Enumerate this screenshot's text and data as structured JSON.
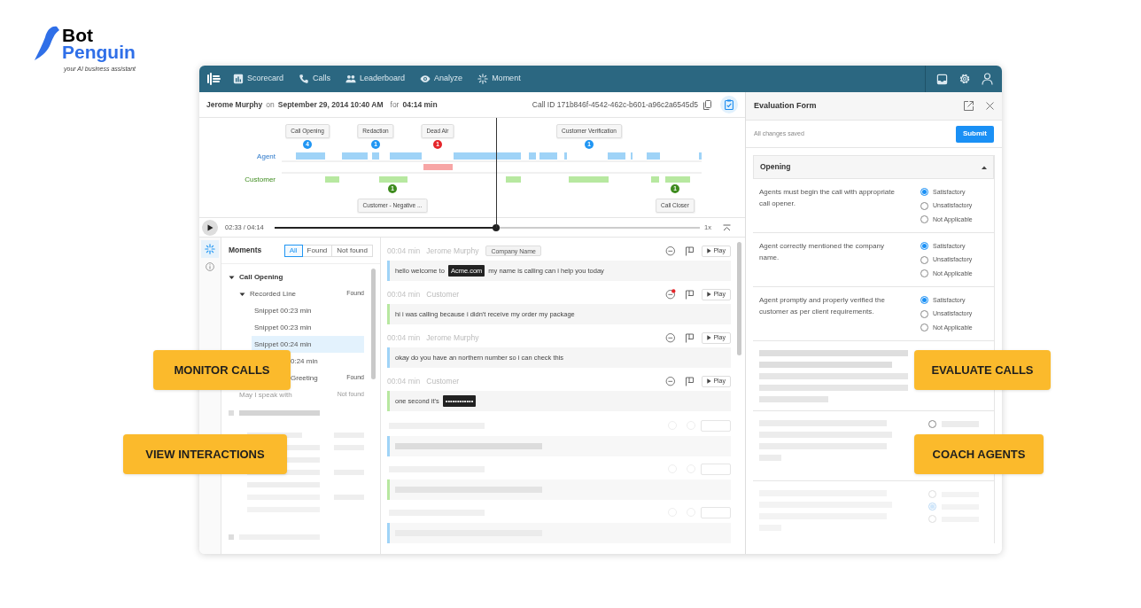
{
  "brand": {
    "name_top": "Bot",
    "name_bottom": "Penguin",
    "tagline": "your AI business assistant"
  },
  "nav": {
    "items": [
      {
        "label": "Scorecard"
      },
      {
        "label": "Calls"
      },
      {
        "label": "Leaderboard"
      },
      {
        "label": "Analyze"
      },
      {
        "label": "Moment"
      }
    ]
  },
  "call": {
    "agent": "Jerome Murphy",
    "on": "on",
    "date": "September 29, 2014 10:40 AM",
    "for": "for",
    "duration": "04:14 min",
    "call_id": "Call ID 171b846f-4542-462c-b601-a96c2a6545d5"
  },
  "timeline": {
    "agent_label": "Agent",
    "customer_label": "Customer",
    "markers": [
      {
        "label": "Call Opening",
        "count": "4",
        "color": "#2196f3",
        "kind": "top"
      },
      {
        "label": "Redaction",
        "count": "1",
        "color": "#2196f3",
        "kind": "top"
      },
      {
        "label": "Dead Air",
        "count": "1",
        "color": "#e5252a",
        "kind": "top"
      },
      {
        "label": "Customer Verification",
        "count": "1",
        "color": "#2196f3",
        "kind": "top"
      },
      {
        "label": "Customer - Negative ...",
        "count": "1",
        "color": "#3d8b1d",
        "kind": "bottom"
      },
      {
        "label": "Call Closer",
        "count": "1",
        "color": "#3d8b1d",
        "kind": "bottom"
      }
    ]
  },
  "player": {
    "time": "02:33 / 04:14",
    "level": 0.52,
    "speed": "1x"
  },
  "moments": {
    "title": "Moments",
    "filters": [
      {
        "label": "All",
        "selected": true
      },
      {
        "label": "Found",
        "selected": false
      },
      {
        "label": "Not found",
        "selected": false
      }
    ],
    "tree": [
      {
        "label": "Call Opening",
        "expanded": true,
        "children": [
          {
            "label": "Recorded Line",
            "status": "Found",
            "expanded": true,
            "disabled": false,
            "children": [
              {
                "label": "Snippet 00:23 min",
                "selected": false,
                "kind": "full"
              },
              {
                "label": "Snippet 00:23 min",
                "selected": false,
                "kind": "full"
              },
              {
                "label": "Snippet 00:24 min",
                "selected": true,
                "kind": "full"
              },
              {
                "label": "0:24 min",
                "selected": false,
                "kind": "clipped"
              }
            ]
          },
          {
            "label": "Greeting",
            "status": "Found",
            "disabled": false,
            "kind": "clipped"
          },
          {
            "label": "May I speak with",
            "status": "Not found",
            "disabled": true,
            "kind": "full"
          }
        ]
      }
    ]
  },
  "transcript": [
    {
      "time": "00:04 min",
      "speaker": "Jerome Murphy",
      "kind": "agent",
      "tag": "Company Name",
      "alert": false,
      "play": "Play",
      "parts": [
        {
          "text": "hello welcome to",
          "redacted": false
        },
        {
          "text": "Acme.com",
          "redacted": true
        },
        {
          "text": "my name is calling can i help you today",
          "redacted": false
        }
      ]
    },
    {
      "time": "00:04 min",
      "speaker": "Customer",
      "kind": "customer",
      "alert": true,
      "play": "Play",
      "parts": [
        {
          "text": "hi i was calling because i didn't receive my order my package",
          "redacted": false
        }
      ]
    },
    {
      "time": "00:04 min",
      "speaker": "Jerome Murphy",
      "kind": "agent",
      "alert": false,
      "play": "Play",
      "parts": [
        {
          "text": "okay do you have an northern number so i can check this",
          "redacted": false
        }
      ]
    },
    {
      "time": "00:04 min",
      "speaker": "Customer",
      "kind": "customer",
      "alert": false,
      "play": "Play",
      "parts": [
        {
          "text": "one second it's",
          "redacted": false
        },
        {
          "text": "••••••••••••",
          "redacted": true
        }
      ]
    }
  ],
  "evaluation": {
    "title": "Evaluation Form",
    "save_status": "All changes saved",
    "submit": "Submit",
    "section": {
      "title": "Opening",
      "expanded": true,
      "questions": [
        {
          "text": "Agents must begin the call with appropriate call opener.",
          "options": [
            {
              "label": "Satisfactory",
              "selected": true
            },
            {
              "label": "Unsatisfactory",
              "selected": false
            },
            {
              "label": "Not Applicable",
              "selected": false
            }
          ]
        },
        {
          "text": "Agent correctly mentioned the company name.",
          "options": [
            {
              "label": "Satisfactory",
              "selected": true
            },
            {
              "label": "Unsatisfactory",
              "selected": false
            },
            {
              "label": "Not Applicable",
              "selected": false
            }
          ]
        },
        {
          "text": "Agent promptly and properly verified the customer as per client requirements.",
          "options": [
            {
              "label": "Satisfactory",
              "selected": true
            },
            {
              "label": "Unsatisfactory",
              "selected": false
            },
            {
              "label": "Not Applicable",
              "selected": false
            }
          ]
        }
      ]
    },
    "placeholder_questions": [
      {
        "options": [
          {
            "selected": false
          }
        ]
      },
      {
        "options": [
          {
            "selected": false
          },
          {
            "selected": true
          },
          {
            "selected": false
          }
        ]
      }
    ]
  },
  "callouts": [
    {
      "label": "MONITOR CALLS"
    },
    {
      "label": "EVALUATE CALLS"
    },
    {
      "label": "VIEW INTERACTIONS"
    },
    {
      "label": "COACH AGENTS"
    }
  ]
}
